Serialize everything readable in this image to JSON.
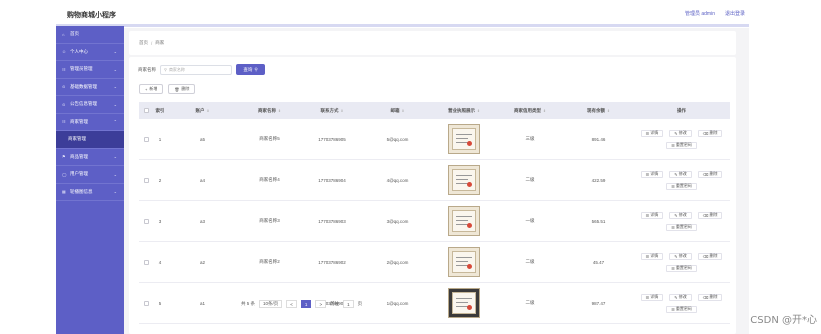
{
  "header": {
    "app_title": "购物商城小程序",
    "user_label": "管理员 admin",
    "logout_label": "退出登录"
  },
  "sidebar": {
    "items": [
      {
        "label": "首页",
        "icon": "home-icon",
        "chev": ""
      },
      {
        "label": "个人中心",
        "icon": "user-icon",
        "chev": "⌄"
      },
      {
        "label": "管理员管理",
        "icon": "admin-icon",
        "chev": "⌄"
      },
      {
        "label": "基础数据管理",
        "icon": "data-icon",
        "chev": "⌄"
      },
      {
        "label": "公告信息管理",
        "icon": "notice-icon",
        "chev": "⌄"
      },
      {
        "label": "商家管理",
        "icon": "shop-icon",
        "chev": "⌃"
      },
      {
        "label": "商家管理",
        "icon": "",
        "chev": "",
        "sub": true
      },
      {
        "label": "商品管理",
        "icon": "goods-icon",
        "chev": "⌄"
      },
      {
        "label": "用户管理",
        "icon": "users-icon",
        "chev": "⌄"
      },
      {
        "label": "轮播图信息",
        "icon": "carousel-icon",
        "chev": "⌄"
      }
    ]
  },
  "breadcrumb": {
    "home": "首页",
    "sep": "/",
    "current": "商家"
  },
  "search": {
    "label": "商家名称",
    "placeholder": "商家名称",
    "button": "查询"
  },
  "actions": {
    "add": "新增",
    "delete": "删除"
  },
  "table": {
    "headers": {
      "index": "索引",
      "account": "账户",
      "name": "商家名称",
      "phone": "联系方式",
      "email": "邮箱",
      "license": "营业执照展示",
      "level": "商家信用类型",
      "balance": "现有余额",
      "ops": "操作"
    },
    "rows": [
      {
        "index": "1",
        "account": "a5",
        "name": "商家名称5",
        "phone": "17703786905",
        "email": "5@qq.com",
        "level": "三级",
        "balance": "891.46",
        "dark": false
      },
      {
        "index": "2",
        "account": "a4",
        "name": "商家名称4",
        "phone": "17703786904",
        "email": "4@qq.com",
        "level": "二级",
        "balance": "422.59",
        "dark": false
      },
      {
        "index": "3",
        "account": "a3",
        "name": "商家名称3",
        "phone": "17703786903",
        "email": "3@qq.com",
        "level": "一级",
        "balance": "565.51",
        "dark": false
      },
      {
        "index": "4",
        "account": "a2",
        "name": "商家名称2",
        "phone": "17703786902",
        "email": "2@qq.com",
        "level": "二级",
        "balance": "45.47",
        "dark": false
      },
      {
        "index": "5",
        "account": "a1",
        "name": "商家名称1",
        "phone": "17703786901",
        "email": "1@qq.com",
        "level": "二级",
        "balance": "987.47",
        "dark": true
      }
    ],
    "op_labels": {
      "detail": "详情",
      "edit": "修改",
      "remove": "删除",
      "reset": "重置密码"
    }
  },
  "pager": {
    "total": "共 5 条",
    "page_size": "10条/页",
    "prev": "<",
    "page": "1",
    "next": ">",
    "goto": "前往",
    "goto_page": "1",
    "goto_suffix": "页"
  },
  "watermark": "CSDN @开*心"
}
